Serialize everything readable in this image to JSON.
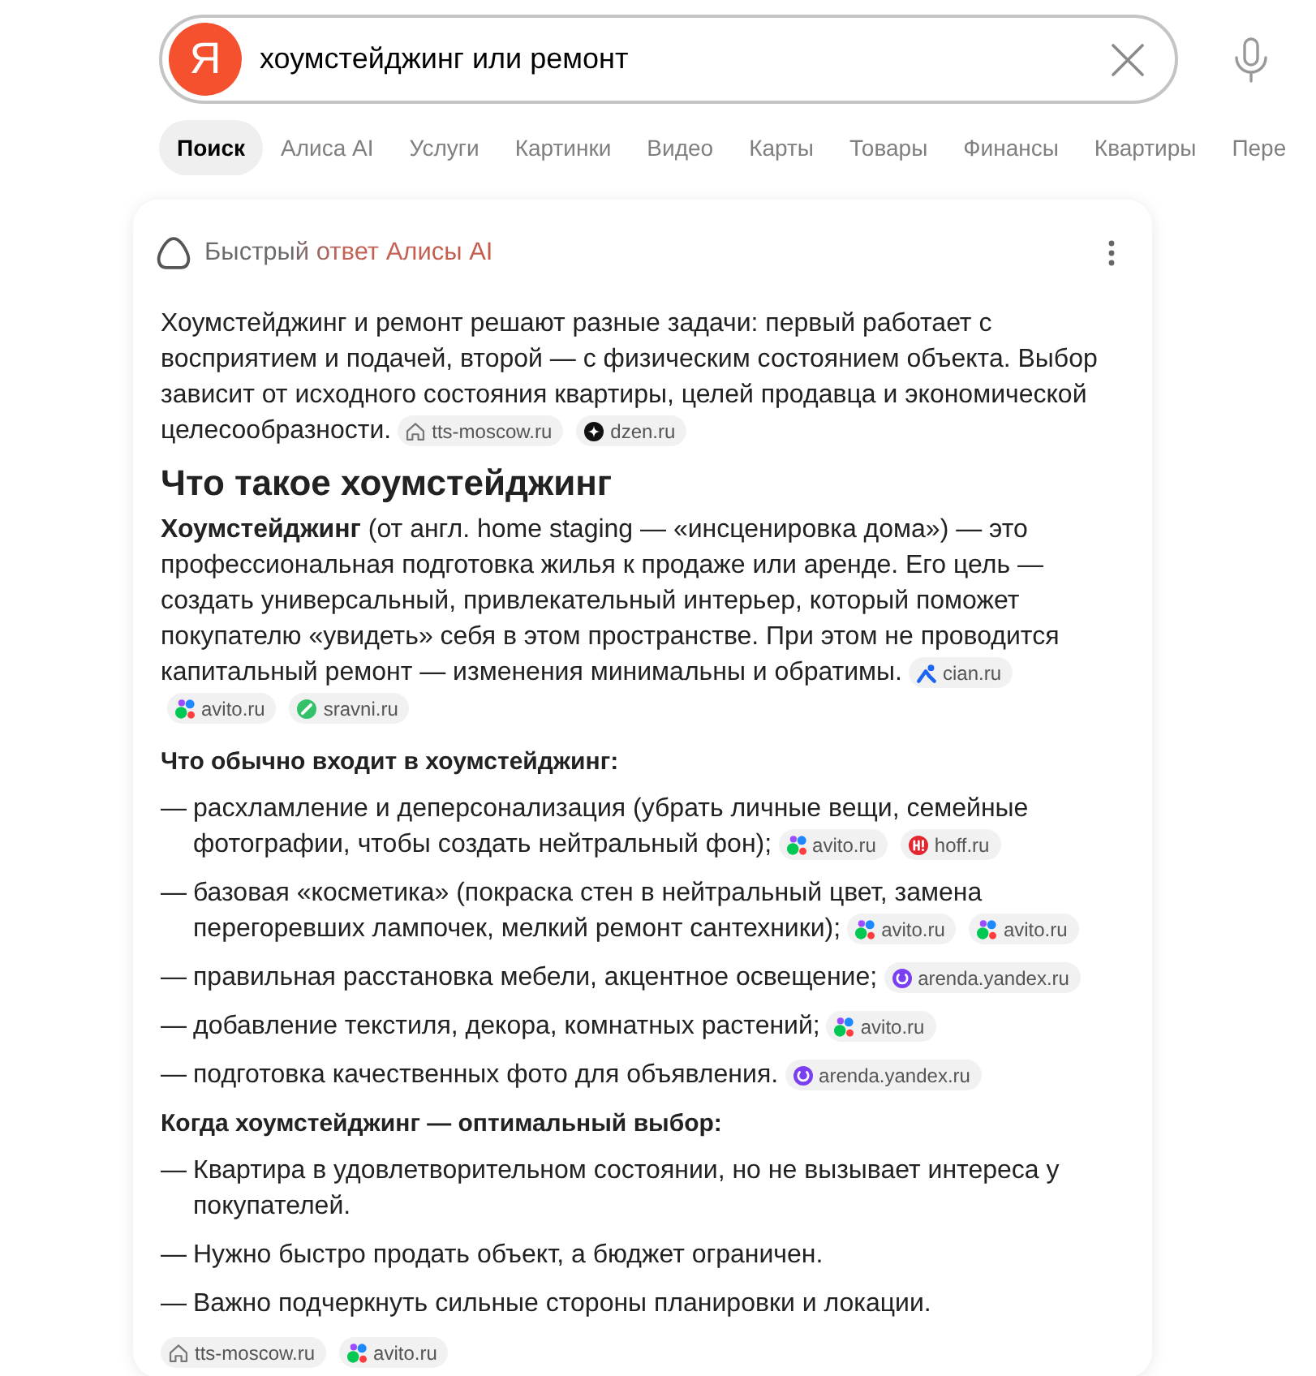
{
  "search": {
    "logo_text": "Я",
    "value": "хоумстейджинг или ремонт"
  },
  "tabs": [
    {
      "label": "Поиск",
      "selected": true
    },
    {
      "label": "Алиса AI",
      "selected": false
    },
    {
      "label": "Услуги",
      "selected": false
    },
    {
      "label": "Картинки",
      "selected": false
    },
    {
      "label": "Видео",
      "selected": false
    },
    {
      "label": "Карты",
      "selected": false
    },
    {
      "label": "Товары",
      "selected": false
    },
    {
      "label": "Финансы",
      "selected": false
    },
    {
      "label": "Квартиры",
      "selected": false
    },
    {
      "label": "Пере",
      "selected": false
    }
  ],
  "answer": {
    "title": "Быстрый ответ Алисы AI",
    "blocks": [
      {
        "kind": "paragraph",
        "text": "Хоумстейджинг и ремонт решают разные задачи: первый работает с восприятием и подачей, второй — с физическим состоянием объекта. Выбор зависит от исходного состояния квартиры, целей продавца и экономической целесообразности.",
        "sources": [
          {
            "kind": "house",
            "label": "tts-moscow.ru"
          },
          {
            "kind": "star",
            "label": "dzen.ru"
          }
        ]
      },
      {
        "kind": "heading",
        "text": "Что такое хоумстейджинг"
      },
      {
        "kind": "paragraph",
        "text": "**Хоумстейджинг** (от англ. home staging — «инсценировка дома») — это профессиональная подготовка жилья к продаже или аренде. Его цель — создать универсальный, привлекательный интерьер, который поможет покупателю «увидеть» себя в этом пространстве. При этом не проводится капитальный ремонт — изменения минимальны и обратимы.",
        "sources": [
          {
            "kind": "figure",
            "label": "cian.ru"
          },
          {
            "kind": "dots",
            "label": "avito.ru"
          },
          {
            "kind": "slash",
            "label": "sravni.ru"
          }
        ]
      },
      {
        "kind": "subheading",
        "text": "Что обычно входит в хоумстейджинг:"
      },
      {
        "kind": "list",
        "items": [
          {
            "marker": "—",
            "text": "расхламление и деперсонализация (убрать личные вещи, семейные фотографии, чтобы создать нейтральный фон);",
            "sources": [
              {
                "kind": "dots",
                "label": "avito.ru"
              },
              {
                "kind": "bars",
                "label": "hoff.ru"
              }
            ]
          },
          {
            "marker": "—",
            "text": "базовая «косметика» (покраска стен в нейтральный цвет, замена перегоревших лампочек, мелкий ремонт сантехники);",
            "sources": [
              {
                "kind": "dots",
                "label": "avito.ru"
              },
              {
                "kind": "dots",
                "label": "avito.ru"
              }
            ]
          },
          {
            "marker": "—",
            "text": "правильная расстановка мебели, акцентное освещение;",
            "sources": [
              {
                "kind": "ring",
                "label": "arenda.yandex.ru"
              }
            ]
          },
          {
            "marker": "—",
            "text": "добавление текстиля, декора, комнатных растений;",
            "sources": [
              {
                "kind": "dots",
                "label": "avito.ru"
              }
            ]
          },
          {
            "marker": "—",
            "text": "подготовка качественных фото для объявления.",
            "sources": [
              {
                "kind": "ring",
                "label": "arenda.yandex.ru"
              }
            ]
          }
        ]
      },
      {
        "kind": "subheading",
        "text": "Когда хоумстейджинг — оптимальный выбор:"
      },
      {
        "kind": "list",
        "items": [
          {
            "marker": "—",
            "text": "Квартира в удовлетворительном состоянии, но не вызывает интереса у покупателей."
          },
          {
            "marker": "—",
            "text": "Нужно быстро продать объект, а бюджет ограничен."
          },
          {
            "marker": "—",
            "text": "Важно подчеркнуть сильные стороны планировки и локации."
          }
        ]
      },
      {
        "kind": "sources",
        "sources": [
          {
            "kind": "house",
            "label": "tts-moscow.ru"
          },
          {
            "kind": "dots",
            "label": "avito.ru"
          }
        ]
      }
    ]
  }
}
